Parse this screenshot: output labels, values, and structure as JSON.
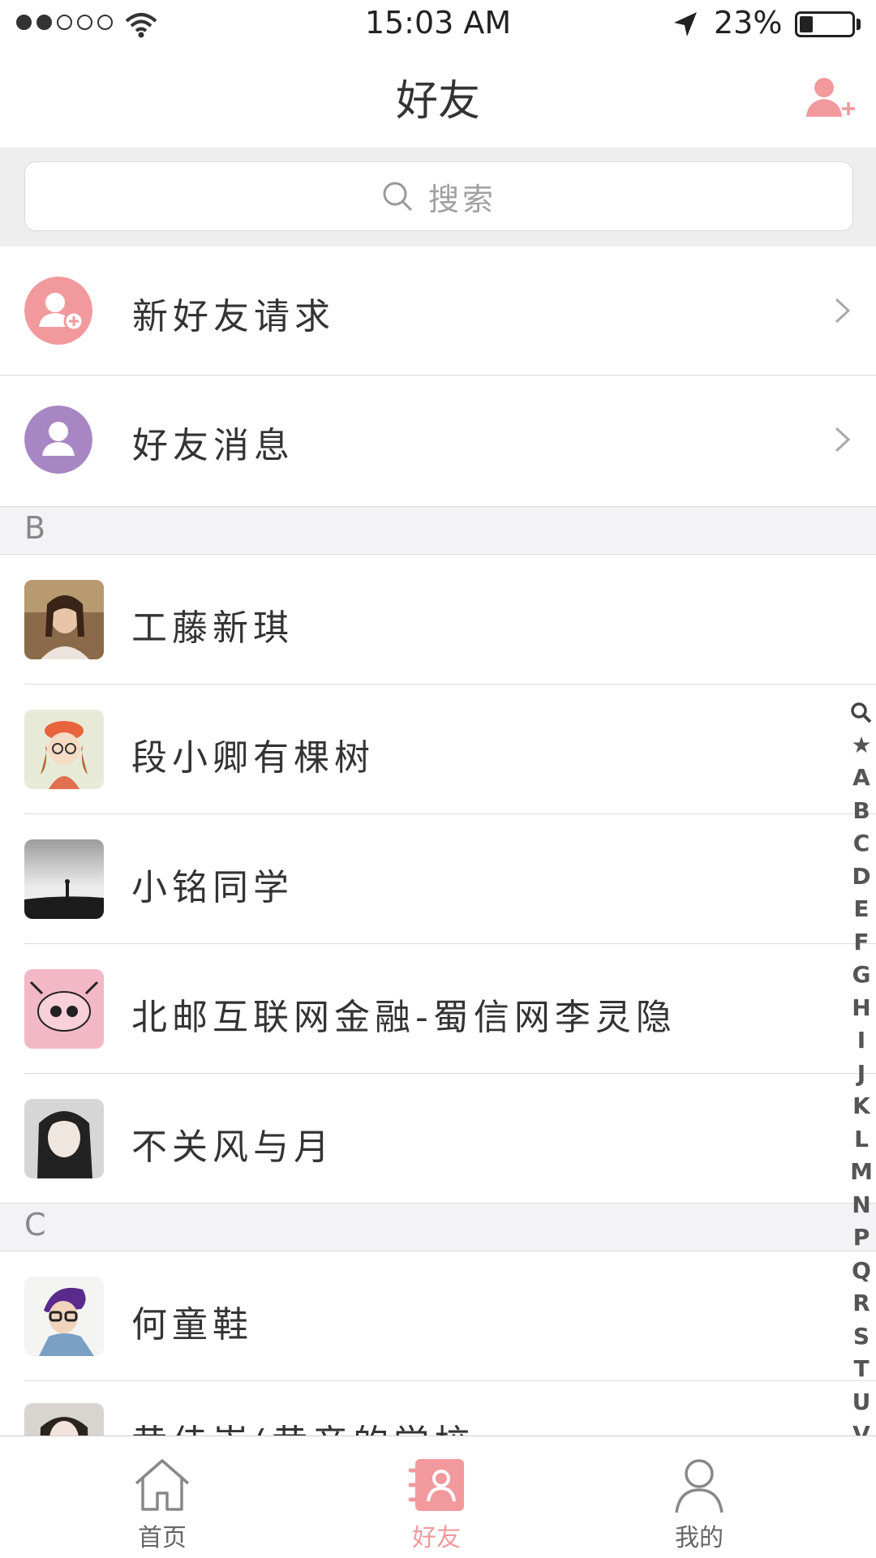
{
  "status_bar": {
    "time": "15:03 AM",
    "battery": "23%"
  },
  "header": {
    "title": "好友"
  },
  "search": {
    "placeholder": "搜索"
  },
  "special_rows": [
    {
      "label": "新好友请求",
      "color": "#f2999d"
    },
    {
      "label": "好友消息",
      "color": "#a886c4"
    }
  ],
  "sections": [
    {
      "letter": "B",
      "contacts": [
        "工藤新琪",
        "段小卿有棵树",
        "小铭同学",
        "北邮互联网金融-蜀信网李灵隐",
        "不关风与月"
      ]
    },
    {
      "letter": "C",
      "contacts": [
        "何童鞋",
        "黄佳崇(黄帝的学校"
      ]
    }
  ],
  "index_bar": [
    "search-icon",
    "★",
    "A",
    "B",
    "C",
    "D",
    "E",
    "F",
    "G",
    "H",
    "I",
    "J",
    "K",
    "L",
    "M",
    "N",
    "P",
    "Q",
    "R",
    "S",
    "T",
    "U",
    "V"
  ],
  "tabs": [
    {
      "label": "首页",
      "icon": "home-icon",
      "active": false
    },
    {
      "label": "好友",
      "icon": "contacts-icon",
      "active": true
    },
    {
      "label": "我的",
      "icon": "profile-icon",
      "active": false
    }
  ],
  "colors": {
    "accent": "#f2999d",
    "purple": "#a886c4",
    "text": "#333333",
    "muted": "#888888"
  }
}
